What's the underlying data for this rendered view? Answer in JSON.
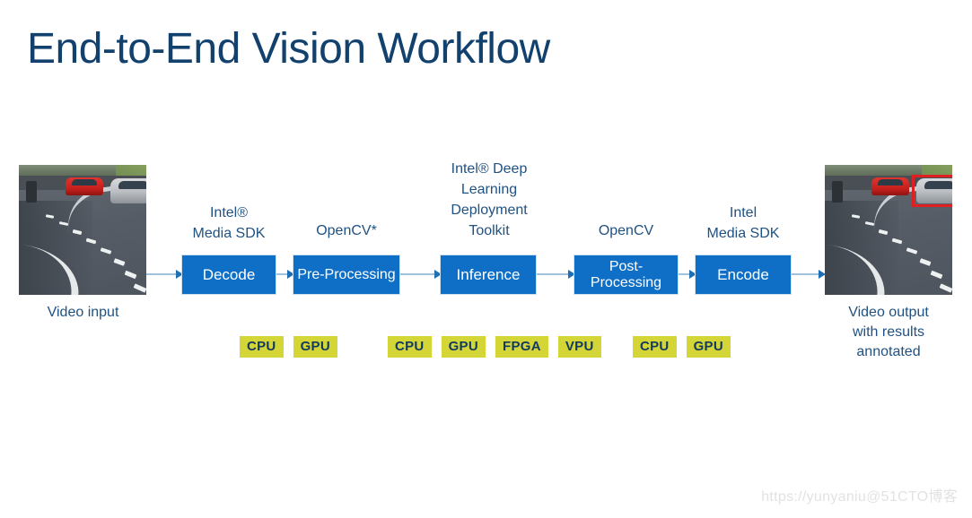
{
  "slide": {
    "title": "End-to-End Vision Workflow",
    "title_color": "#12416e",
    "background_color": "#ffffff"
  },
  "theme": {
    "box_blue": "#0f6fc6",
    "label_blue": "#1f5182",
    "badge_yellow": "#d4d638",
    "badge_text": "#123a5e",
    "arrow_blue": "#9fc3dd",
    "detection_box_red": "#e02020"
  },
  "media": {
    "input": {
      "caption": "Video input",
      "scene_description": "road-with-cars-photo",
      "has_detection_box": false
    },
    "output": {
      "caption": "Video output\nwith results\nannotated",
      "caption_line1": "Video output",
      "caption_line2": "with results",
      "caption_line3": "annotated",
      "scene_description": "road-with-cars-photo",
      "has_detection_box": true
    }
  },
  "pipeline": {
    "stages": [
      {
        "id": "decode",
        "label": "Decode",
        "tech_label": "Intel® Media SDK",
        "tech_label_line1": "Intel®",
        "tech_label_line2": "Media SDK",
        "accelerators": [
          "CPU",
          "GPU"
        ]
      },
      {
        "id": "pre-processing",
        "label": "Pre-Processing",
        "tech_label": "OpenCV*",
        "accelerators": []
      },
      {
        "id": "inference",
        "label": "Inference",
        "tech_label": "Intel® Deep Learning Deployment Toolkit",
        "tech_label_line1": "Intel® Deep",
        "tech_label_line2": "Learning",
        "tech_label_line3": "Deployment",
        "tech_label_line4": "Toolkit",
        "accelerators": [
          "CPU",
          "GPU",
          "FPGA",
          "VPU"
        ]
      },
      {
        "id": "post-processing",
        "label": "Post-Processing",
        "label_line1": "Post-",
        "label_line2": "Processing",
        "tech_label": "OpenCV",
        "accelerators": []
      },
      {
        "id": "encode",
        "label": "Encode",
        "tech_label": "Intel Media SDK",
        "tech_label_line1": "Intel",
        "tech_label_line2": "Media SDK",
        "accelerators": [
          "CPU",
          "GPU"
        ]
      }
    ],
    "accelerator_groups": [
      {
        "id": "decode-accelerators",
        "items": [
          "CPU",
          "GPU"
        ]
      },
      {
        "id": "inference-accelerators",
        "items": [
          "CPU",
          "GPU",
          "FPGA",
          "VPU"
        ]
      },
      {
        "id": "encode-accelerators",
        "items": [
          "CPU",
          "GPU"
        ]
      }
    ]
  },
  "watermark": {
    "text": "https://yunyaniu@51CTO博客"
  }
}
